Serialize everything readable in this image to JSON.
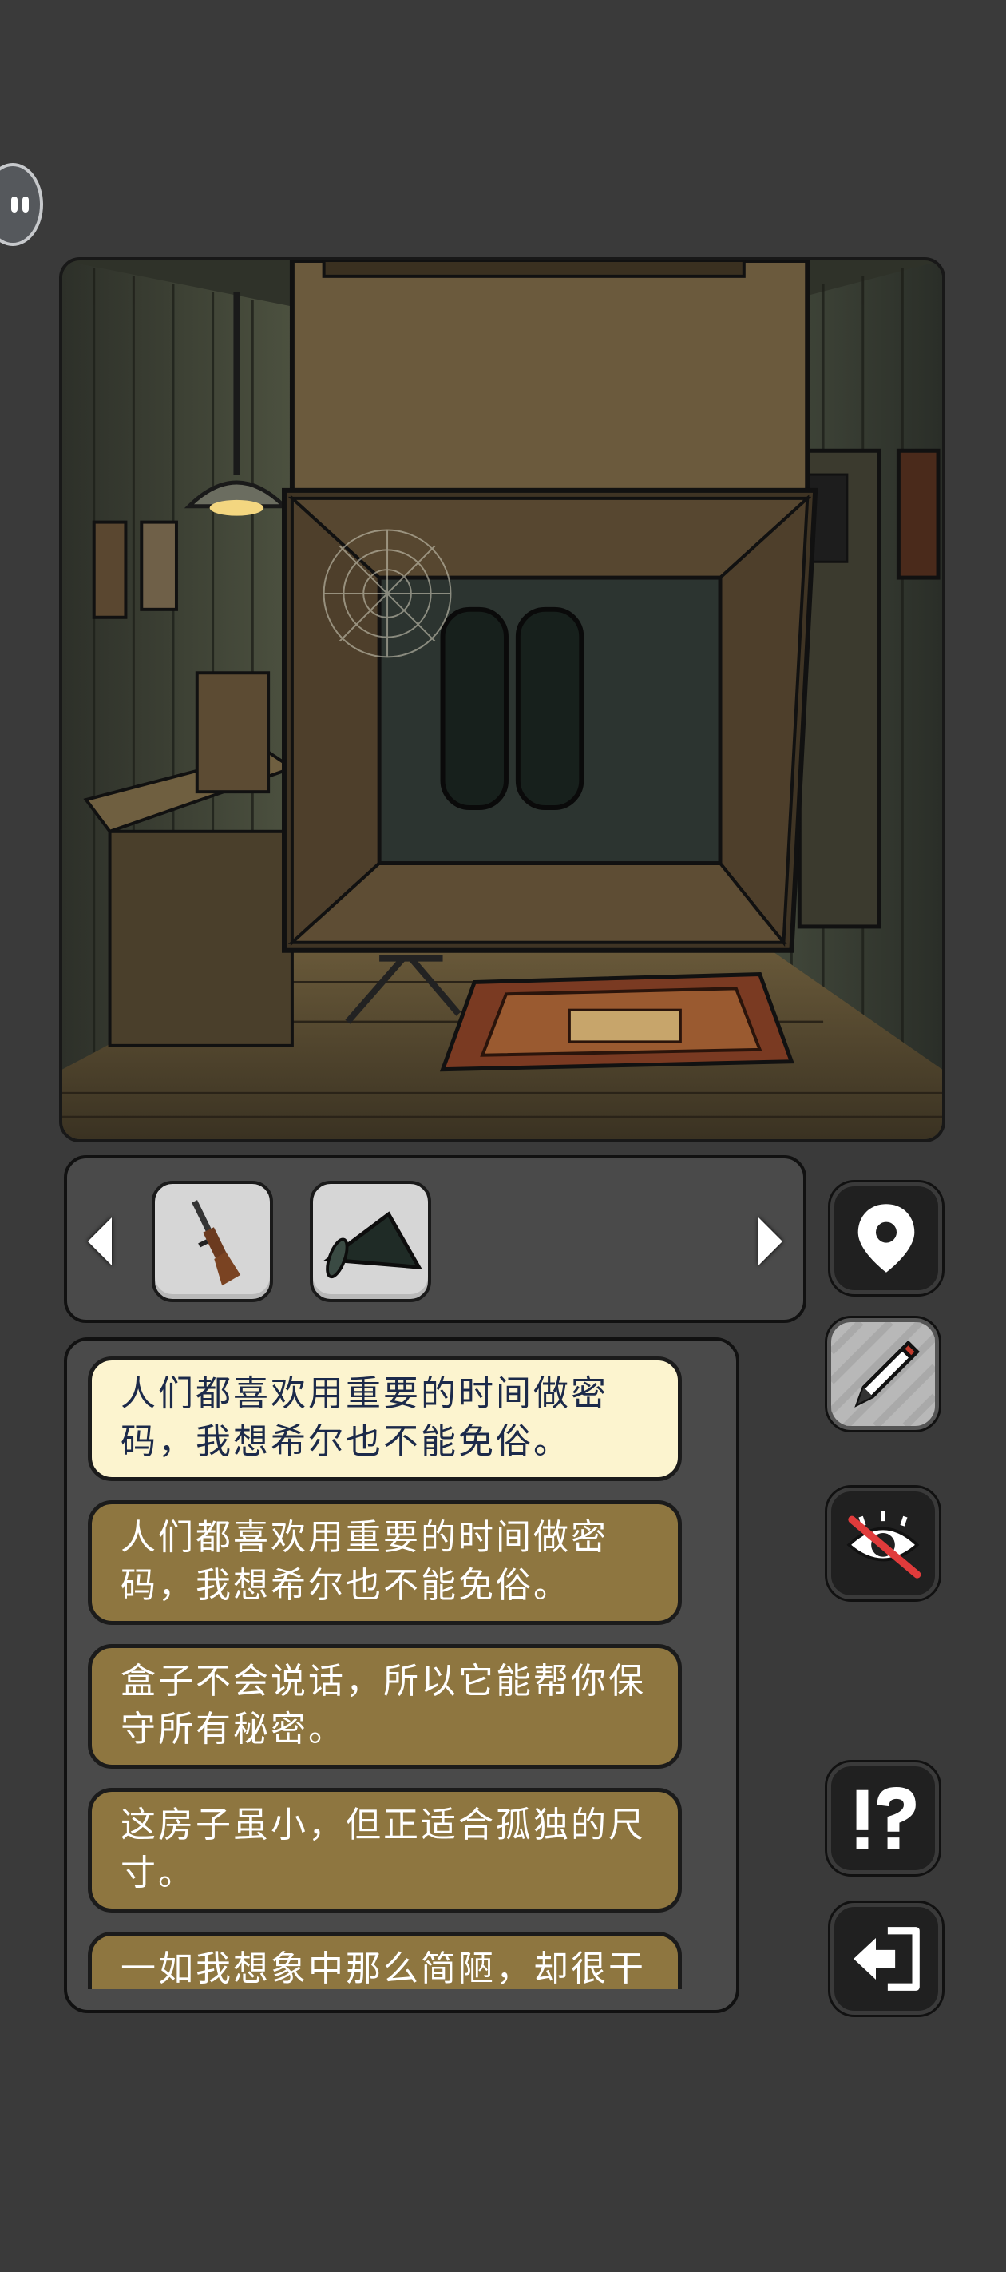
{
  "inventory": {
    "items": [
      {
        "name": "rifle"
      },
      {
        "name": "megaphone"
      }
    ]
  },
  "side_buttons": [
    "location-pin-icon",
    "pencil-icon",
    "hide-eye-icon",
    "help-icon",
    "exit-icon"
  ],
  "hints": [
    {
      "text": "人们都喜欢用重要的时间做密码，我想希尔也不能免俗。",
      "active": true
    },
    {
      "text": "人们都喜欢用重要的时间做密码，我想希尔也不能免俗。",
      "active": false
    },
    {
      "text": "盒子不会说话，所以它能帮你保守所有秘密。",
      "active": false
    },
    {
      "text": "这房子虽小，但正适合孤独的尺寸。",
      "active": false
    },
    {
      "text": "一如我想象中那么简陋，却很干",
      "active": false
    }
  ],
  "colors": {
    "background": "#3a3a3a",
    "hint_active": "#fcf4cf",
    "hint_inactive": "#8e7640",
    "panel": "#4a4a4a"
  }
}
